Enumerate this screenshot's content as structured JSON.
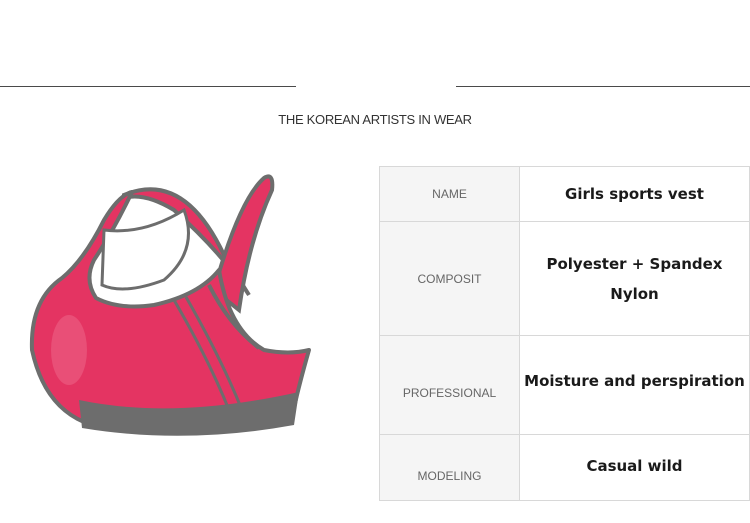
{
  "brand": "THE KOREAN ARTISTS IN WEAR",
  "product_image": {
    "alt_icon": "sports-bra-image",
    "color": "#e43462",
    "trim_color": "#6d6d6d"
  },
  "specs": [
    {
      "label": "NAME",
      "values": [
        "Girls sports vest"
      ]
    },
    {
      "label": "COMPOSIT",
      "values": [
        "Polyester + Spandex",
        "Nylon"
      ]
    },
    {
      "label": "PROFESSIONAL",
      "values": [
        "Moisture and perspiration"
      ]
    },
    {
      "label": "MODELING",
      "values": [
        "Casual wild"
      ]
    }
  ]
}
